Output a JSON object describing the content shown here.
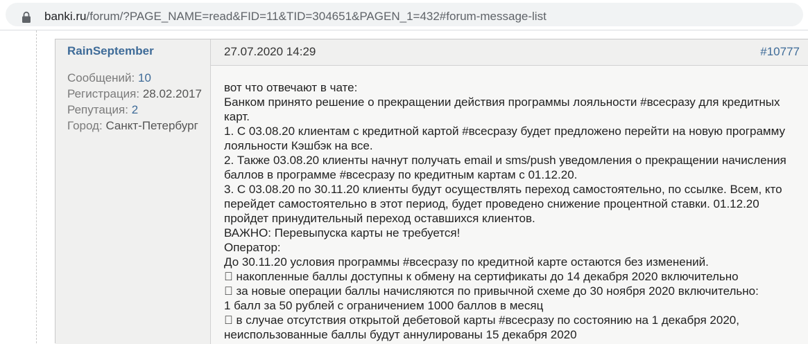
{
  "browser": {
    "url_host": "banki.ru",
    "url_path": "/forum/?PAGE_NAME=read&FID=11&TID=304651&PAGEN_1=432#forum-message-list"
  },
  "post": {
    "author": {
      "name": "RainSeptember",
      "messages_label": "Сообщений:",
      "messages_value": "10",
      "registration_label": "Регистрация:",
      "registration_value": "28.02.2017",
      "reputation_label": "Репутация:",
      "reputation_value": "2",
      "city_label": "Город:",
      "city_value": "Санкт-Петербург"
    },
    "date": "27.07.2020 14:29",
    "message_number": "#10777",
    "lines": [
      "вот что отвечают в чате:",
      "Банком принято решение о прекращении действия программы лояльности #всесразу для кредитных",
      "карт.",
      "1. С 03.08.20 клиентам с кредитной картой #всесразу будет предложено перейти на новую программу",
      "лояльности Кэшбэк на все.",
      "2. Также 03.08.20 клиенты начнут получать email и sms/push уведомления о прекращении начисления",
      "баллов в программе #всесразу по кредитным картам с 01.12.20.",
      "3. С 03.08.20 по 30.11.20 клиенты будут осуществлять переход самостоятельно, по ссылке. Всем, кто",
      "перейдет самостоятельно в этот период, будет проведено снижение процентной ставки. 01.12.20",
      "пройдет принудительный переход оставшихся клиентов.",
      "ВАЖНО: Перевыпуска карты не требуется!",
      "Оператор:",
      "До 30.11.20 условия программы #всесразу по кредитной карте остаются без изменений.",
      "􀂃 накопленные баллы доступны к обмену на сертификаты до 14 декабря 2020 включительно",
      "􀂃 за новые операции баллы начисляются по привычной схеме до 30 ноября 2020 включительно:",
      "1 балл за 50 рублей с ограничением 1000 баллов в месяц",
      "􀂃 в случае отсутствия открытой дебетовой карты #всесразу по состоянию на 1 декабря 2020,",
      "неиспользованные баллы будут аннулированы 15 декабря 2020"
    ]
  }
}
